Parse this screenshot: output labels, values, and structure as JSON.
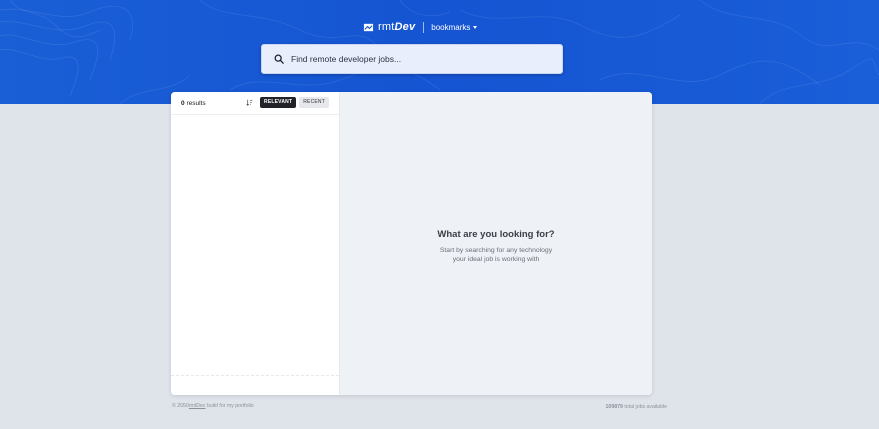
{
  "header": {
    "logo_light": "rmt",
    "logo_bold": "Dev",
    "bookmarks_label": "bookmarks"
  },
  "search": {
    "placeholder": "Find remote developer jobs..."
  },
  "sidebar": {
    "results_count": "0",
    "results_label": "results",
    "sort_relevant": "RELEVANT",
    "sort_recent": "RECENT"
  },
  "main": {
    "empty_title": "What are you looking for?",
    "empty_line1": "Start by searching for any technology",
    "empty_line2": "your ideal job is working with"
  },
  "footer": {
    "copyright_prefix": "© 2050",
    "copyright_link": "rmtDev",
    "copyright_suffix": "build for my portfolio",
    "total_jobs": "109879",
    "total_jobs_label": "total jobs available"
  },
  "colors": {
    "hero_blue": "#1554d2",
    "page_bg": "#dfe3ea",
    "active_sort_bg": "#222328"
  }
}
